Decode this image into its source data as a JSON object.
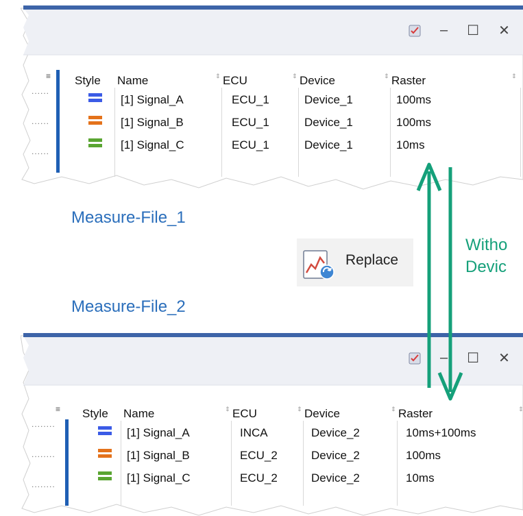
{
  "top_window": {
    "columns": {
      "style": "Style",
      "name": "Name",
      "ecu": "ECU",
      "device": "Device",
      "raster": "Raster"
    },
    "rows": [
      {
        "name": "[1] Signal_A",
        "ecu": "ECU_1",
        "device": "Device_1",
        "raster": "100ms",
        "color": "#3b5be6"
      },
      {
        "name": "[1] Signal_B",
        "ecu": "ECU_1",
        "device": "Device_1",
        "raster": "100ms",
        "color": "#e4721b"
      },
      {
        "name": "[1] Signal_C",
        "ecu": "ECU_1",
        "device": "Device_1",
        "raster": "10ms",
        "color": "#5aa532"
      }
    ],
    "window_controls": {
      "minimize": "–",
      "maximize": "☐",
      "close": "✕"
    }
  },
  "captions": {
    "file1": "Measure-File_1",
    "file2": "Measure-File_2"
  },
  "replace_button": {
    "label": "Replace",
    "icon": "chart-replace-icon"
  },
  "side_note": {
    "line1": "Witho",
    "line2": "Devic"
  },
  "bottom_window": {
    "columns": {
      "style": "Style",
      "name": "Name",
      "ecu": "ECU",
      "device": "Device",
      "raster": "Raster"
    },
    "rows": [
      {
        "name": "[1] Signal_A",
        "ecu": "INCA",
        "device": "Device_2",
        "raster": "10ms+100ms",
        "color": "#3b5be6"
      },
      {
        "name": "[1] Signal_B",
        "ecu": "ECU_2",
        "device": "Device_2",
        "raster": "100ms",
        "color": "#e4721b"
      },
      {
        "name": "[1] Signal_C",
        "ecu": "ECU_2",
        "device": "Device_2",
        "raster": "10ms",
        "color": "#5aa532"
      }
    ],
    "window_controls": {
      "minimize": "–",
      "maximize": "☐",
      "close": "✕"
    }
  },
  "colors": {
    "accent_blue": "#2a6ebb",
    "arrow_green": "#15a07a",
    "window_border": "#3d64a8",
    "title_bar": "#eef0f5"
  }
}
